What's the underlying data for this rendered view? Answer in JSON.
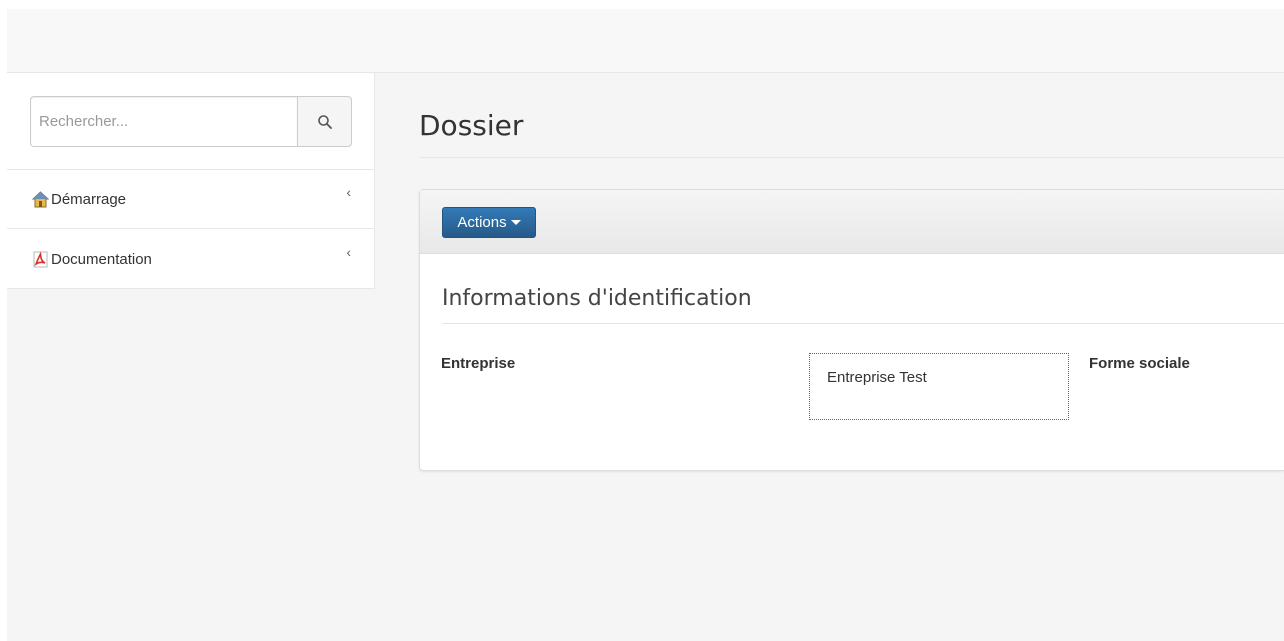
{
  "search": {
    "placeholder": "Rechercher..."
  },
  "sidebar": {
    "items": [
      {
        "label": "Démarrage",
        "icon": "home-icon",
        "chevron": "‹"
      },
      {
        "label": "Documentation",
        "icon": "pdf-icon",
        "chevron": "‹"
      }
    ]
  },
  "main": {
    "page_title": "Dossier",
    "actions_label": "Actions",
    "section_title": "Informations d'identification",
    "fields": [
      {
        "label": "Entreprise",
        "value": "Entreprise Test"
      },
      {
        "label": "Forme sociale",
        "value": ""
      }
    ]
  },
  "colors": {
    "primary_button": "#337ab7",
    "pdf_red": "#d9302c"
  }
}
